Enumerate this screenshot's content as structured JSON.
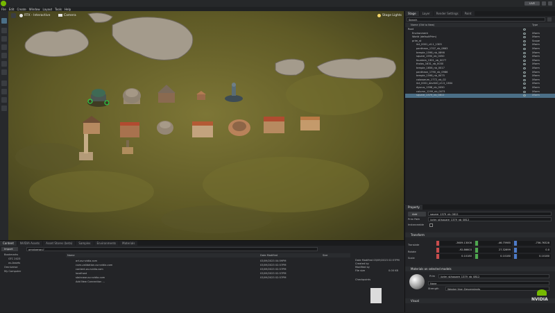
{
  "menubar": {
    "items": [
      "File",
      "Edit",
      "Create",
      "Window",
      "Layout",
      "Tools",
      "Help"
    ]
  },
  "topbar": {
    "right_badge": "LIVE"
  },
  "viewport": {
    "render_mode": "RTX - Interactive",
    "camera_label": "Camera",
    "lights_label": "Stage Lights"
  },
  "stage": {
    "tabs": [
      "Stage",
      "Layer",
      "Render Settings",
      "Paint"
    ],
    "search_placeholder": "Search",
    "col_name": "Name (Old to New)",
    "col_type": "Type",
    "rows": [
      {
        "name": "Root",
        "type": "",
        "level": 0
      },
      {
        "name": "Environment",
        "type": "Xform",
        "level": 1
      },
      {
        "name": "World (defaultPrim)",
        "type": "Xform",
        "level": 1
      },
      {
        "name": "prim_st",
        "type": "Scope",
        "level": 1
      },
      {
        "name": "ilct_0001_c0.1_1305",
        "type": "Xform",
        "level": 2
      },
      {
        "name": "pantheon_1707_nb_0863",
        "type": "Xform",
        "level": 2
      },
      {
        "name": "temple_1598_nb_0898",
        "type": "Xform",
        "level": 2
      },
      {
        "name": "square_1590_nb_0050",
        "type": "Xform",
        "level": 2
      },
      {
        "name": "fountain_1301_nb_0077",
        "type": "Xform",
        "level": 2
      },
      {
        "name": "tholos_1631_nb_0030",
        "type": "Xform",
        "level": 2
      },
      {
        "name": "temple_1658_nb_0017",
        "type": "Xform",
        "level": 2
      },
      {
        "name": "pantheon_1790_nb_0986",
        "type": "Xform",
        "level": 2
      },
      {
        "name": "temple_1598_nb_0075",
        "type": "Xform",
        "level": 2
      },
      {
        "name": "colosseum_1772_nb_02",
        "type": "Xform",
        "level": 2
      },
      {
        "name": "ilct_0001_dev040_c0.3_1384",
        "type": "Xform",
        "level": 2
      },
      {
        "name": "dyscus_1598_nb_0050",
        "type": "Xform",
        "level": 2
      },
      {
        "name": "column_1299_nb_0073",
        "type": "Xform",
        "level": 2
      },
      {
        "name": "square_1379_nb_0812",
        "type": "Xform",
        "level": 2,
        "selected": true
      }
    ]
  },
  "property": {
    "tab": "Property",
    "add_label": "Add",
    "name_value": "square_1379_nb_0812",
    "prim_path_label": "Prim Path",
    "prim_path_value": "/prim_st/square_1379_nb_0812",
    "instanceable_label": "Instanceable",
    "transform_label": "Transform",
    "translate_label": "Translate",
    "rotate_label": "Rotate",
    "scale_label": "Scale",
    "translate": [
      "-3609.13008",
      "-46.75985",
      "-756.76328"
    ],
    "rotate": [
      "-92.86603",
      "27.32699",
      "0.0"
    ],
    "scale": [
      "0.10180",
      "0.10180",
      "0.10180"
    ],
    "materials_label": "Materials on selected models",
    "material_prim": "Prim",
    "material_path": "/prim_st/square_1379_nb_0812",
    "material_none": "None",
    "strength_label": "Strength",
    "strength_value": "Weaker than Descendants",
    "visual_label": "Visual",
    "brand": "NVIDIA"
  },
  "content": {
    "tabs": [
      "Content",
      "NVIDIA Assets",
      "Asset Stores (beta)",
      "Samples",
      "Environments",
      "Materials"
    ],
    "import_label": "Import",
    "path_value": "omniverse://",
    "tree": [
      "Bookmarks",
      "GTC 2023",
      "ov-Assets",
      "Omniverse",
      "My Computer"
    ],
    "col_name": "Name",
    "col_date": "Date Modified",
    "col_size": "Size",
    "files": [
      {
        "name": "art.ov.nvidia.com",
        "date": "03/09/2023 04:59PM"
      },
      {
        "name": "cues-validation.ov.nvidia.com",
        "date": "03/09/2023 02:57PM"
      },
      {
        "name": "content.ov.nvidia.com",
        "date": "03/09/2023 02:57PM"
      },
      {
        "name": "localhost",
        "date": "03/09/2023 02:57PM"
      },
      {
        "name": "staircase.ov.nvidia.com",
        "date": "03/09/2023 02:57PM"
      },
      {
        "name": "Add New Connection ...",
        "date": ""
      }
    ],
    "details": [
      "Date Modified 03/09/2023 02:57PM",
      "Created by",
      "Modified by",
      "File size"
    ],
    "filesize": "0.00 KB",
    "checkpoints_label": "Checkpoints"
  },
  "colors": {
    "accent": "#76b900",
    "select": "#4b6f87",
    "grass": "#6f6a2c"
  }
}
